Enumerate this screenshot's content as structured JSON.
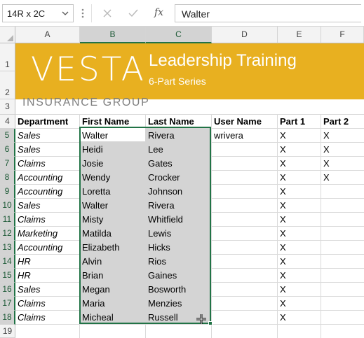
{
  "formula_bar": {
    "name_box": "14R x 2C",
    "fx_label": "fx",
    "content": "Walter"
  },
  "columns": [
    "A",
    "B",
    "C",
    "D",
    "E",
    "F"
  ],
  "rows": [
    "1",
    "2",
    "3",
    "4",
    "5",
    "6",
    "7",
    "8",
    "9",
    "10",
    "11",
    "12",
    "13",
    "14",
    "15",
    "16",
    "17",
    "18",
    "19"
  ],
  "banner": {
    "logo": "VESTA",
    "title": "Leadership Training",
    "subtitle": "6-Part Series",
    "tagline": "INSURANCE  GROUP"
  },
  "table": {
    "headers": [
      "Department",
      "First Name",
      "Last Name",
      "User Name",
      "Part 1",
      "Part 2"
    ],
    "rows": [
      [
        "Sales",
        "Walter",
        "Rivera",
        "wrivera",
        "X",
        "X"
      ],
      [
        "Sales",
        "Heidi",
        "Lee",
        "",
        "X",
        "X"
      ],
      [
        "Claims",
        "Josie",
        "Gates",
        "",
        "X",
        "X"
      ],
      [
        "Accounting",
        "Wendy",
        "Crocker",
        "",
        "X",
        "X"
      ],
      [
        "Accounting",
        "Loretta",
        "Johnson",
        "",
        "X",
        ""
      ],
      [
        "Sales",
        "Walter",
        "Rivera",
        "",
        "X",
        ""
      ],
      [
        "Claims",
        "Misty",
        "Whitfield",
        "",
        "X",
        ""
      ],
      [
        "Marketing",
        "Matilda",
        "Lewis",
        "",
        "X",
        ""
      ],
      [
        "Accounting",
        "Elizabeth",
        "Hicks",
        "",
        "X",
        ""
      ],
      [
        "HR",
        "Alvin",
        "Rios",
        "",
        "X",
        ""
      ],
      [
        "HR",
        "Brian",
        "Gaines",
        "",
        "X",
        ""
      ],
      [
        "Sales",
        "Megan",
        "Bosworth",
        "",
        "X",
        ""
      ],
      [
        "Claims",
        "Maria",
        "Menzies",
        "",
        "X",
        ""
      ],
      [
        "Claims",
        "Micheal",
        "Russell",
        "",
        "X",
        ""
      ]
    ]
  },
  "colors": {
    "banner": "#e8b020",
    "selection_border": "#217346",
    "selection_fill": "#d4d4d4"
  }
}
